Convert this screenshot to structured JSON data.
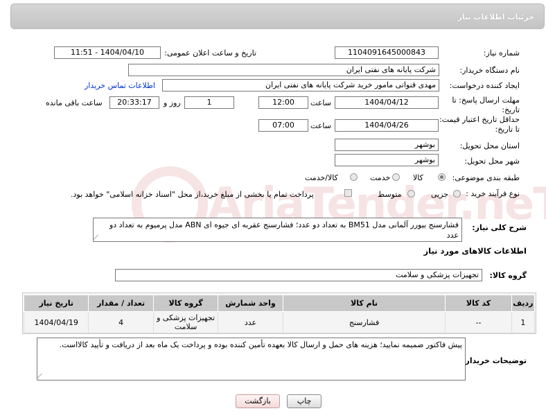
{
  "header": {
    "title": "جزئیات اطلاعات نیاز"
  },
  "fields": {
    "need_number_label": "شماره نیاز:",
    "need_number": "1104091645000843",
    "announce_label": "تاریخ و ساعت اعلان عمومی:",
    "announce_value": "1404/04/10 - 11:51",
    "buyer_org_label": "نام دستگاه خریدار:",
    "buyer_org": "شرکت پایانه های نفتی ایران",
    "requester_label": "ایجاد کننده درخواست:",
    "requester": "مهدی قنواتی مامور خرید شرکت پایانه های نفتی ایران",
    "buyer_contact_link": "اطلاعات تماس خریدار",
    "reply_deadline_label": "مهلت ارسال پاسخ: تا تاریخ:",
    "reply_date": "1404/04/12",
    "time_label": "ساعت",
    "reply_time": "12:00",
    "days_value": "1",
    "days_label": "روز و",
    "remaining_time": "20:33:17",
    "remaining_label": "ساعت باقی مانده",
    "price_validity_label": "حداقل تاریخ اعتبار قیمت: تا تاریخ:",
    "price_date": "1404/04/26",
    "price_time_label": "ساعت",
    "price_time": "07:00",
    "province_label": "استان محل تحویل:",
    "province": "بوشهر",
    "city_label": "شهر محل تحویل:",
    "city": "بوشهر",
    "category_label": "طبقه بندی موضوعی:",
    "category_options": [
      "کالا",
      "خدمت",
      "کالا/خدمت"
    ],
    "process_label": "نوع فرآیند خرید :",
    "process_options": [
      "جزیی",
      "متوسط"
    ],
    "payment_note": "پرداخت تمام یا بخشی از مبلغ خرید،از محل \"اسناد خزانه اسلامی\" خواهد بود.",
    "description_label": "شرح کلی نیاز:",
    "description": "فشارسنج بیورر آلمانی مدل BM51 به تعداد دو عدد؛ فشارسنج عقربه ای جیوه ای ABN مدل پرمیوم به تعداد دو عدد",
    "goods_info_title": "اطلاعات کالاهای مورد نیاز",
    "goods_group_label": "گروه کالا:",
    "goods_group": "تجهیزات پزشکی و سلامت"
  },
  "table": {
    "headers": [
      "ردیف",
      "کد کالا",
      "نام کالا",
      "واحد شمارش",
      "گروه کالا",
      "تعداد / مقدار",
      "تاریخ نیاز"
    ],
    "rows": [
      [
        "1",
        "--",
        "فشارسنج",
        "عدد",
        "تجهیزات پزشکی و سلامت",
        "4",
        "1404/04/19"
      ]
    ]
  },
  "buyer_notes_label": "توضیحات خریدار:",
  "buyer_notes": "پیش فاکتور ضمیمه نمایید؛ هزینه های حمل و ارسال کالا بعهده تأمین کننده بوده و پرداخت یک ماه بعد از دریافت و تأیید کالااست.",
  "buttons": {
    "print": "چاپ",
    "back": "بازگشت"
  },
  "watermark": {
    "text": "AriaTender.neT"
  },
  "colors": {
    "header_bg": "#c8c8c8",
    "link": "#0033cc",
    "back_button": "#f2dada"
  }
}
